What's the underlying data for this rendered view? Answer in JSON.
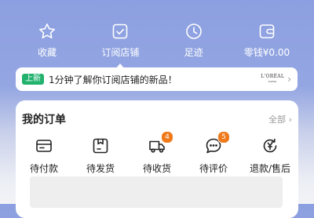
{
  "quick_actions": [
    {
      "label": "收藏",
      "icon": "star-icon"
    },
    {
      "label": "订阅店铺",
      "icon": "store-subscribe-icon"
    },
    {
      "label": "足迹",
      "icon": "clock-icon"
    },
    {
      "label": "零钱¥0.00",
      "icon": "wallet-icon"
    }
  ],
  "notice": {
    "tag": "上新",
    "text": "1分钟了解你订阅店铺的新品！",
    "brand": "L'ORÉAL",
    "brand_sub": "PARIS"
  },
  "orders": {
    "title": "我的订单",
    "all_label": "全部",
    "items": [
      {
        "label": "待付款",
        "icon": "card-payment-icon",
        "badge": ""
      },
      {
        "label": "待发货",
        "icon": "package-icon",
        "badge": ""
      },
      {
        "label": "待收货",
        "icon": "truck-icon",
        "badge": "4"
      },
      {
        "label": "待评价",
        "icon": "chat-review-icon",
        "badge": "5"
      },
      {
        "label": "退款/售后",
        "icon": "refund-icon",
        "badge": ""
      }
    ]
  },
  "colors": {
    "header_bg": "#8c9fe0",
    "tag_green": "#23b26d",
    "badge_orange": "#f07a1b"
  }
}
